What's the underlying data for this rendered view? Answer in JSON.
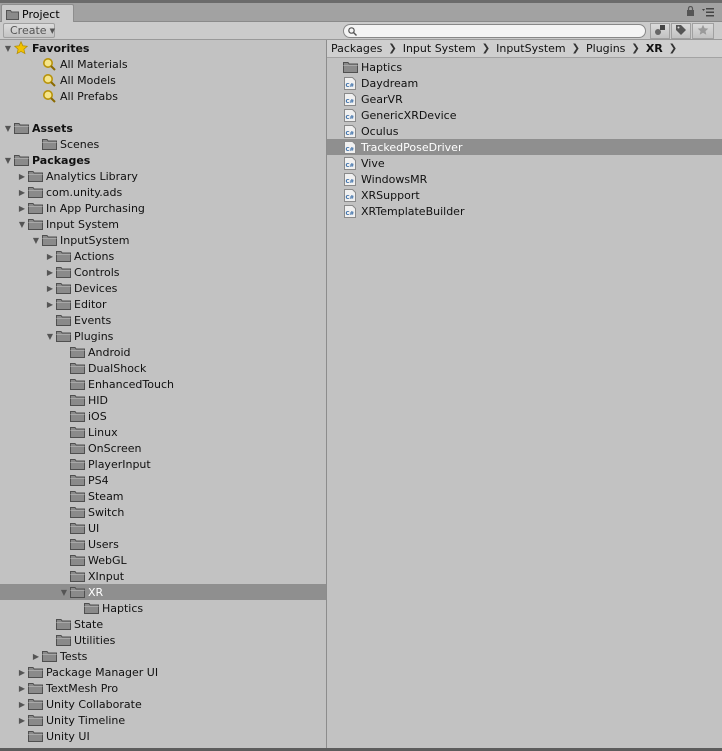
{
  "window": {
    "tab_label": "Project"
  },
  "toolbar": {
    "create_label": "Create",
    "search_placeholder": ""
  },
  "tree": [
    {
      "label": "Favorites",
      "icon": "star-icon",
      "indent": 0,
      "arrow": "down",
      "bold": true
    },
    {
      "label": "All Materials",
      "icon": "search-filter-icon",
      "indent": 2,
      "arrow": "none"
    },
    {
      "label": "All Models",
      "icon": "search-filter-icon",
      "indent": 2,
      "arrow": "none"
    },
    {
      "label": "All Prefabs",
      "icon": "search-filter-icon",
      "indent": 2,
      "arrow": "none"
    },
    {
      "label": "",
      "spacer": true
    },
    {
      "label": "Assets",
      "icon": "folder-icon",
      "indent": 0,
      "arrow": "down",
      "bold": true
    },
    {
      "label": "Scenes",
      "icon": "folder-icon",
      "indent": 2,
      "arrow": "none"
    },
    {
      "label": "Packages",
      "icon": "folder-icon",
      "indent": 0,
      "arrow": "down",
      "bold": true
    },
    {
      "label": "Analytics Library",
      "icon": "folder-icon",
      "indent": 1,
      "arrow": "right"
    },
    {
      "label": "com.unity.ads",
      "icon": "folder-icon",
      "indent": 1,
      "arrow": "right"
    },
    {
      "label": "In App Purchasing",
      "icon": "folder-icon",
      "indent": 1,
      "arrow": "right"
    },
    {
      "label": "Input System",
      "icon": "folder-icon",
      "indent": 1,
      "arrow": "down"
    },
    {
      "label": "InputSystem",
      "icon": "folder-icon",
      "indent": 2,
      "arrow": "down"
    },
    {
      "label": "Actions",
      "icon": "folder-icon",
      "indent": 3,
      "arrow": "right"
    },
    {
      "label": "Controls",
      "icon": "folder-icon",
      "indent": 3,
      "arrow": "right"
    },
    {
      "label": "Devices",
      "icon": "folder-icon",
      "indent": 3,
      "arrow": "right"
    },
    {
      "label": "Editor",
      "icon": "folder-icon",
      "indent": 3,
      "arrow": "right"
    },
    {
      "label": "Events",
      "icon": "folder-icon",
      "indent": 3,
      "arrow": "none"
    },
    {
      "label": "Plugins",
      "icon": "folder-icon",
      "indent": 3,
      "arrow": "down"
    },
    {
      "label": "Android",
      "icon": "folder-icon",
      "indent": 4,
      "arrow": "none"
    },
    {
      "label": "DualShock",
      "icon": "folder-icon",
      "indent": 4,
      "arrow": "none"
    },
    {
      "label": "EnhancedTouch",
      "icon": "folder-icon",
      "indent": 4,
      "arrow": "none"
    },
    {
      "label": "HID",
      "icon": "folder-icon",
      "indent": 4,
      "arrow": "none"
    },
    {
      "label": "iOS",
      "icon": "folder-icon",
      "indent": 4,
      "arrow": "none"
    },
    {
      "label": "Linux",
      "icon": "folder-icon",
      "indent": 4,
      "arrow": "none"
    },
    {
      "label": "OnScreen",
      "icon": "folder-icon",
      "indent": 4,
      "arrow": "none"
    },
    {
      "label": "PlayerInput",
      "icon": "folder-icon",
      "indent": 4,
      "arrow": "none"
    },
    {
      "label": "PS4",
      "icon": "folder-icon",
      "indent": 4,
      "arrow": "none"
    },
    {
      "label": "Steam",
      "icon": "folder-icon",
      "indent": 4,
      "arrow": "none"
    },
    {
      "label": "Switch",
      "icon": "folder-icon",
      "indent": 4,
      "arrow": "none"
    },
    {
      "label": "UI",
      "icon": "folder-icon",
      "indent": 4,
      "arrow": "none"
    },
    {
      "label": "Users",
      "icon": "folder-icon",
      "indent": 4,
      "arrow": "none"
    },
    {
      "label": "WebGL",
      "icon": "folder-icon",
      "indent": 4,
      "arrow": "none"
    },
    {
      "label": "XInput",
      "icon": "folder-icon",
      "indent": 4,
      "arrow": "none"
    },
    {
      "label": "XR",
      "icon": "folder-icon",
      "indent": 4,
      "arrow": "down",
      "selected": true
    },
    {
      "label": "Haptics",
      "icon": "folder-icon",
      "indent": 5,
      "arrow": "none"
    },
    {
      "label": "State",
      "icon": "folder-icon",
      "indent": 3,
      "arrow": "none"
    },
    {
      "label": "Utilities",
      "icon": "folder-icon",
      "indent": 3,
      "arrow": "none"
    },
    {
      "label": "Tests",
      "icon": "folder-icon",
      "indent": 2,
      "arrow": "right"
    },
    {
      "label": "Package Manager UI",
      "icon": "folder-icon",
      "indent": 1,
      "arrow": "right"
    },
    {
      "label": "TextMesh Pro",
      "icon": "folder-icon",
      "indent": 1,
      "arrow": "right"
    },
    {
      "label": "Unity Collaborate",
      "icon": "folder-icon",
      "indent": 1,
      "arrow": "right"
    },
    {
      "label": "Unity Timeline",
      "icon": "folder-icon",
      "indent": 1,
      "arrow": "right"
    },
    {
      "label": "Unity UI",
      "icon": "folder-icon",
      "indent": 1,
      "arrow": "none"
    }
  ],
  "breadcrumb": [
    "Packages",
    "Input System",
    "InputSystem",
    "Plugins",
    "XR"
  ],
  "files": [
    {
      "label": "Haptics",
      "icon": "folder-icon"
    },
    {
      "label": "Daydream",
      "icon": "csharp-script-icon"
    },
    {
      "label": "GearVR",
      "icon": "csharp-script-icon"
    },
    {
      "label": "GenericXRDevice",
      "icon": "csharp-script-icon"
    },
    {
      "label": "Oculus",
      "icon": "csharp-script-icon"
    },
    {
      "label": "TrackedPoseDriver",
      "icon": "csharp-script-icon",
      "selected": true
    },
    {
      "label": "Vive",
      "icon": "csharp-script-icon"
    },
    {
      "label": "WindowsMR",
      "icon": "csharp-script-icon"
    },
    {
      "label": "XRSupport",
      "icon": "csharp-script-icon"
    },
    {
      "label": "XRTemplateBuilder",
      "icon": "csharp-script-icon"
    }
  ],
  "colors": {
    "selection": "#8f8f8f",
    "background": "#c2c2c2",
    "folder": "#7a7a7a",
    "star": "#f2c200"
  }
}
